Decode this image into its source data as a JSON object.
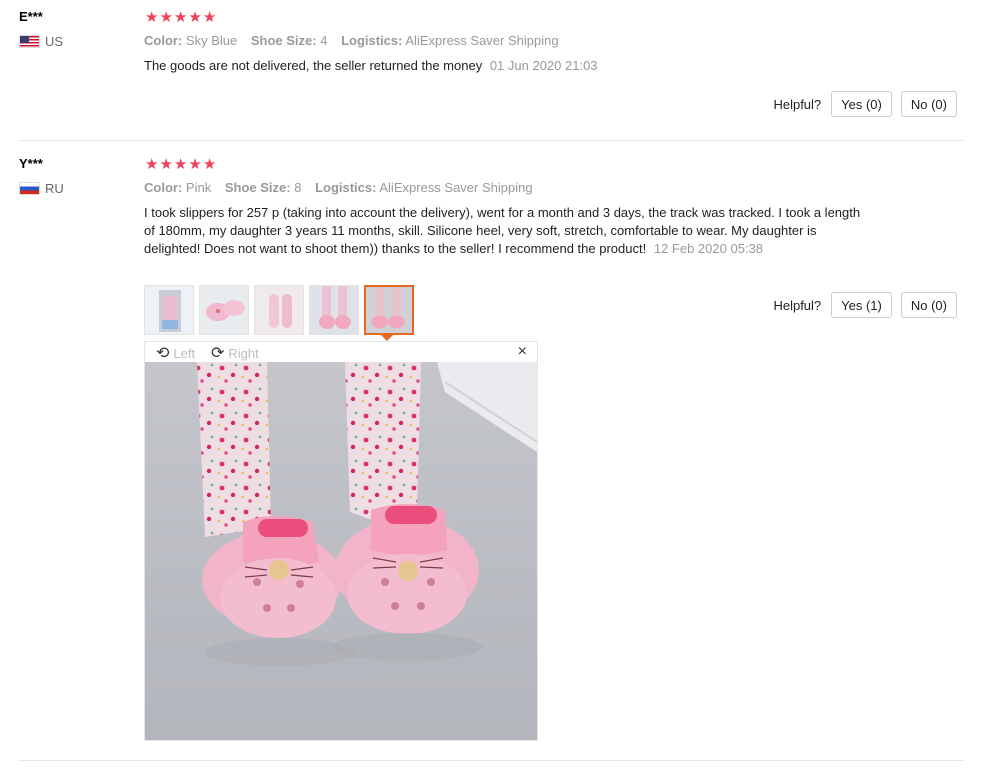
{
  "reviews": [
    {
      "user": "E***",
      "country": "US",
      "stars": [
        "★",
        "★",
        "★",
        "★",
        "★"
      ],
      "color_label": "Color:",
      "color_value": "Sky Blue",
      "size_label": "Shoe Size:",
      "size_value": "4",
      "logistics_label": "Logistics:",
      "logistics_value": "AliExpress Saver Shipping",
      "text": "The goods are not delivered, the seller returned the money",
      "date": "01 Jun 2020 21:03",
      "helpful_label": "Helpful?",
      "yes_label": "Yes (0)",
      "no_label": "No (0)"
    },
    {
      "user": "Y***",
      "country": "RU",
      "stars": [
        "★",
        "★",
        "★",
        "★",
        "★"
      ],
      "color_label": "Color:",
      "color_value": "Pink",
      "size_label": "Shoe Size:",
      "size_value": "8",
      "logistics_label": "Logistics:",
      "logistics_value": "AliExpress Saver Shipping",
      "text": "I took slippers for 257 р (taking into account the delivery), went for a month and 3 days, the track was tracked. I took a length of 180mm, my daughter 3 years 11 months, skill. Silicone heel, very soft, stretch, comfortable to wear. My daughter is delighted! Does not want to shoot them)) thanks to the seller! I recommend the product!",
      "date": "12 Feb 2020 05:38",
      "helpful_label": "Helpful?",
      "yes_label": "Yes (1)",
      "no_label": "No (0)"
    }
  ],
  "viewer": {
    "rotate_left_label": "Left",
    "rotate_right_label": "Right",
    "close_glyph": "×",
    "rotate_left_icon": "⟲",
    "rotate_right_icon": "⟳"
  },
  "colors": {
    "star": "#f0405a",
    "active_thumb": "#e66a1e"
  }
}
